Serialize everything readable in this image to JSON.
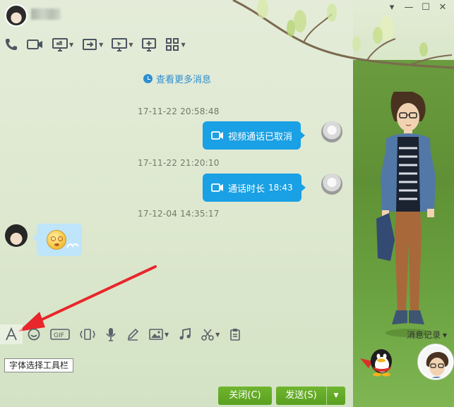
{
  "window": {
    "minimize_glyph": "—",
    "maximize_glyph": "☐",
    "close_glyph": "✕",
    "skin_glyph": "▾"
  },
  "toolbar": {
    "items": [
      "phone-icon",
      "video-icon",
      "screen-share-icon",
      "remote-icon",
      "remote-assist-icon",
      "screen-note-icon",
      "apps-icon"
    ]
  },
  "chat": {
    "more_messages": "查看更多消息",
    "messages": [
      {
        "time": "17-11-22 20:58:48",
        "text": "视频通话已取消",
        "duration": ""
      },
      {
        "time": "17-11-22 21:20:10",
        "text": "通话时长",
        "duration": "18:43"
      },
      {
        "time": "17-12-04 14:35:17"
      }
    ]
  },
  "input_toolbar": {
    "items": [
      "font-icon",
      "emoji-icon",
      "gif-icon",
      "shake-icon",
      "voice-icon",
      "handwrite-icon",
      "image-icon",
      "music-icon",
      "screenshot-icon",
      "clipboard-icon"
    ],
    "gif_label": "GIF",
    "message_record": "消息记录",
    "tooltip": "字体选择工具栏"
  },
  "buttons": {
    "close": "关闭(C)",
    "send": "发送(S)",
    "send_dropdown": "▼",
    "record_dropdown": "▾"
  },
  "colors": {
    "accent_blue": "#1aa0e4",
    "button_green": "#5aa020",
    "arrow_red": "#e8262b"
  }
}
